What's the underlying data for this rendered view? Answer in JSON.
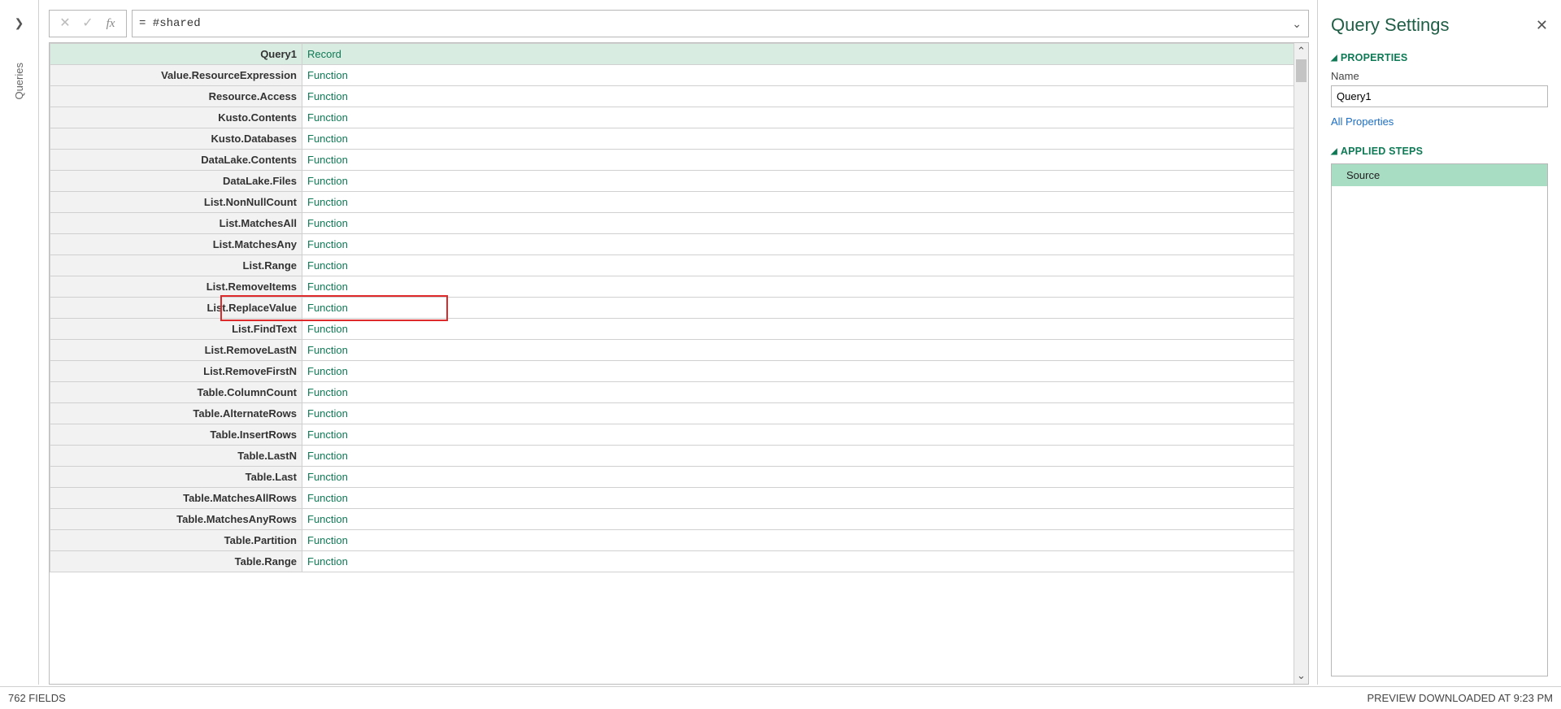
{
  "rail": {
    "label": "Queries"
  },
  "formula": {
    "value": "= #shared"
  },
  "grid": {
    "header": {
      "key": "Query1",
      "value": "Record"
    },
    "highlight_key": "List.ReplaceValue",
    "rows": [
      {
        "key": "Value.ResourceExpression",
        "value": "Function"
      },
      {
        "key": "Resource.Access",
        "value": "Function"
      },
      {
        "key": "Kusto.Contents",
        "value": "Function"
      },
      {
        "key": "Kusto.Databases",
        "value": "Function"
      },
      {
        "key": "DataLake.Contents",
        "value": "Function"
      },
      {
        "key": "DataLake.Files",
        "value": "Function"
      },
      {
        "key": "List.NonNullCount",
        "value": "Function"
      },
      {
        "key": "List.MatchesAll",
        "value": "Function"
      },
      {
        "key": "List.MatchesAny",
        "value": "Function"
      },
      {
        "key": "List.Range",
        "value": "Function"
      },
      {
        "key": "List.RemoveItems",
        "value": "Function"
      },
      {
        "key": "List.ReplaceValue",
        "value": "Function"
      },
      {
        "key": "List.FindText",
        "value": "Function"
      },
      {
        "key": "List.RemoveLastN",
        "value": "Function"
      },
      {
        "key": "List.RemoveFirstN",
        "value": "Function"
      },
      {
        "key": "Table.ColumnCount",
        "value": "Function"
      },
      {
        "key": "Table.AlternateRows",
        "value": "Function"
      },
      {
        "key": "Table.InsertRows",
        "value": "Function"
      },
      {
        "key": "Table.LastN",
        "value": "Function"
      },
      {
        "key": "Table.Last",
        "value": "Function"
      },
      {
        "key": "Table.MatchesAllRows",
        "value": "Function"
      },
      {
        "key": "Table.MatchesAnyRows",
        "value": "Function"
      },
      {
        "key": "Table.Partition",
        "value": "Function"
      },
      {
        "key": "Table.Range",
        "value": "Function"
      }
    ]
  },
  "settings": {
    "title": "Query Settings",
    "properties_label": "PROPERTIES",
    "name_label": "Name",
    "name_value": "Query1",
    "all_properties": "All Properties",
    "steps_label": "APPLIED STEPS",
    "steps": [
      {
        "label": "Source",
        "selected": true
      }
    ]
  },
  "status": {
    "left": "762 FIELDS",
    "right": "PREVIEW DOWNLOADED AT 9:23 PM"
  }
}
